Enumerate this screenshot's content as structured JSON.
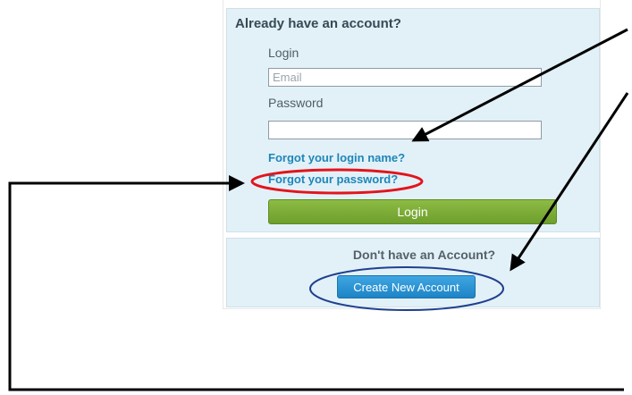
{
  "login_panel": {
    "title": "Already have an account?",
    "login_label": "Login",
    "email_placeholder": "Email",
    "email_value": "",
    "password_label": "Password",
    "password_value": "",
    "forgot_login_name_link": "Forgot your login name?",
    "forgot_password_link": "Forgot your password?",
    "login_button": "Login"
  },
  "signup_panel": {
    "question": "Don't have an Account?",
    "create_button": "Create New Account"
  },
  "annotations": {
    "arrow_color": "#000000",
    "forgot_password_highlight_color": "#e3141c",
    "create_account_highlight_color": "#1f3f8f"
  },
  "colors": {
    "panel_background": "#e2f1f8",
    "link_color": "#1f86b9",
    "login_button_green": "#7aab37",
    "create_button_blue": "#2b93d4"
  }
}
